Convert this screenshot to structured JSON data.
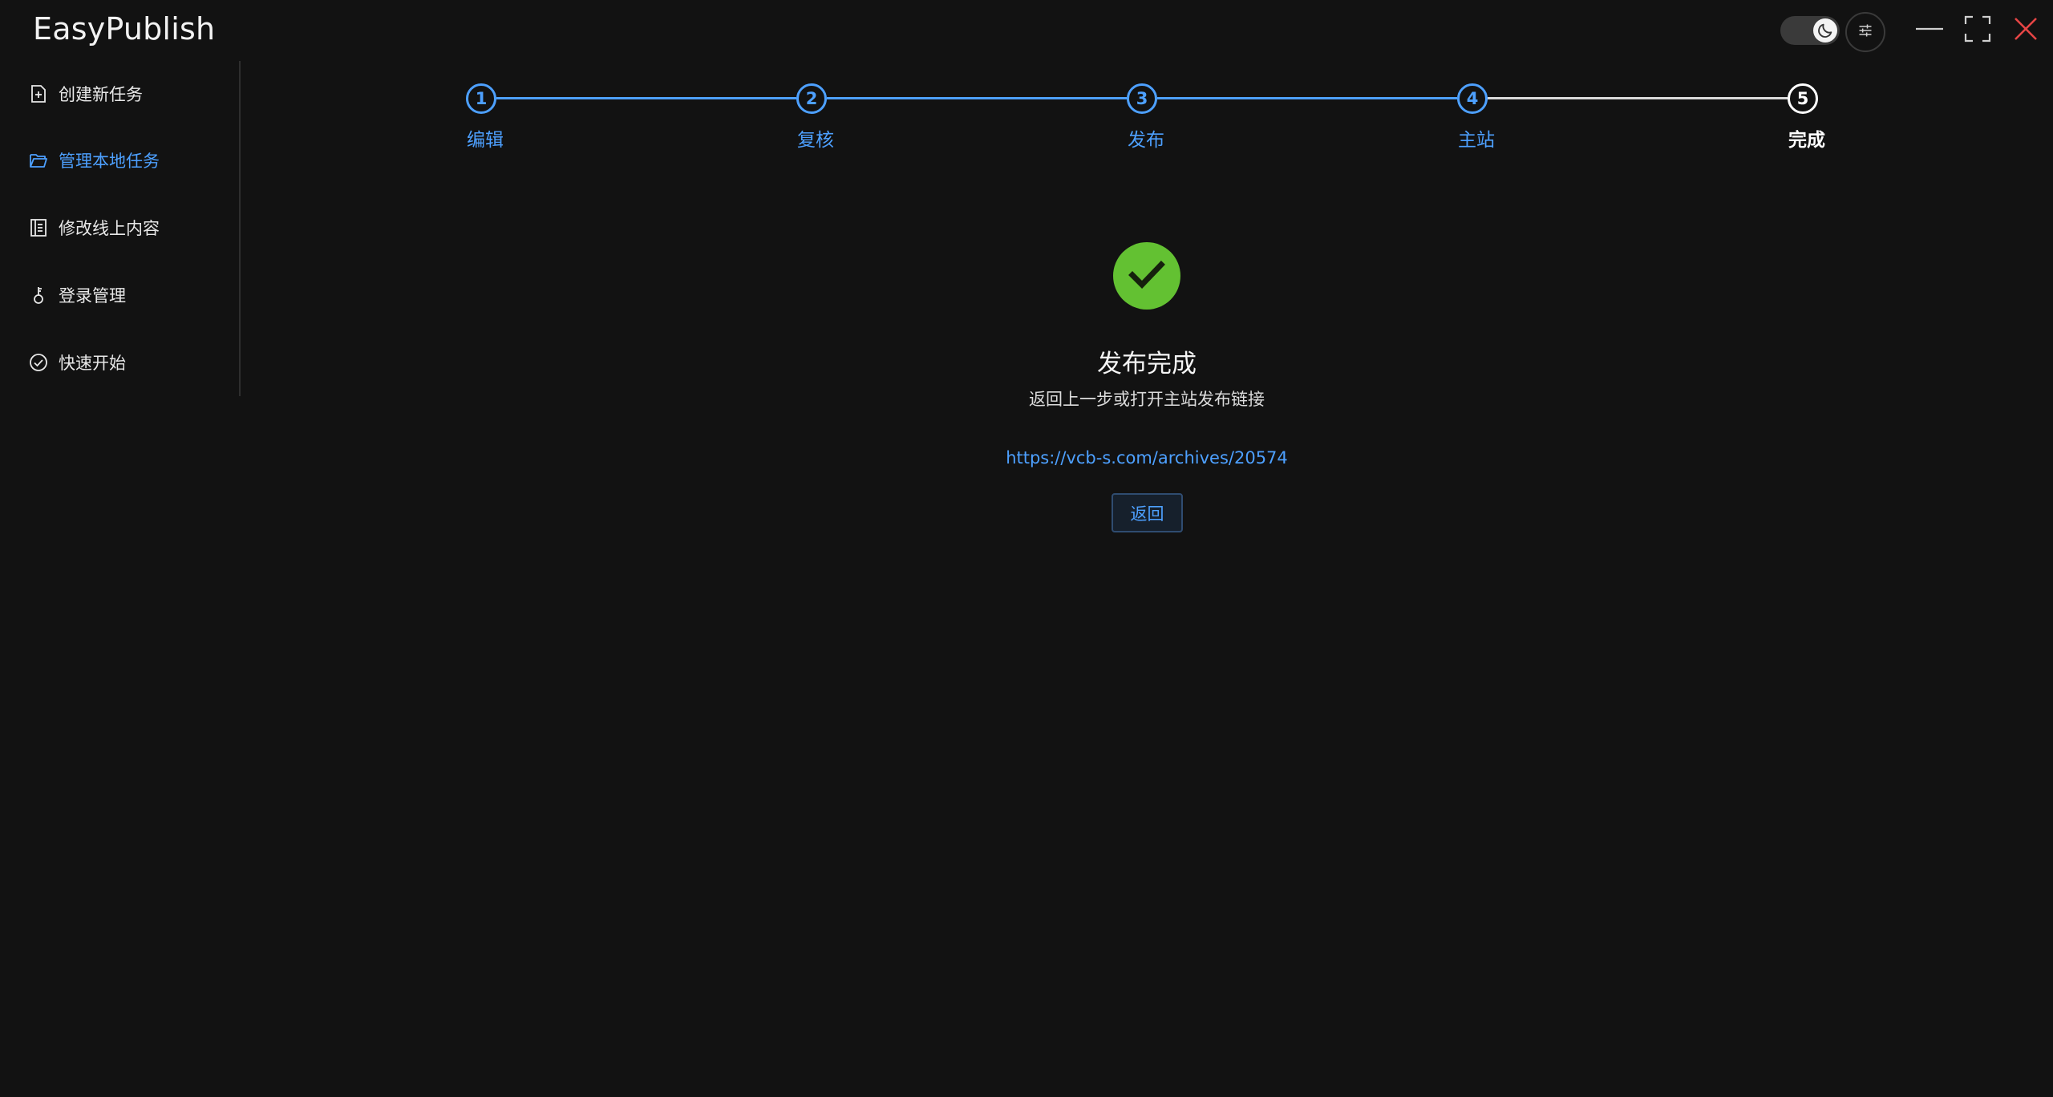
{
  "app": {
    "title": "EasyPublish"
  },
  "topbar": {
    "theme_toggle_icon": "moon-icon",
    "settings_icon": "sliders-icon",
    "minimize_icon": "minimize-icon",
    "maximize_icon": "maximize-icon",
    "close_icon": "close-icon",
    "close_color": "#e64545"
  },
  "sidebar": {
    "items": [
      {
        "label": "创建新任务",
        "icon": "file-add-icon",
        "active": false
      },
      {
        "label": "管理本地任务",
        "icon": "folder-open-icon",
        "active": true
      },
      {
        "label": "修改线上内容",
        "icon": "document-list-icon",
        "active": false
      },
      {
        "label": "登录管理",
        "icon": "key-icon",
        "active": false
      },
      {
        "label": "快速开始",
        "icon": "check-circle-icon",
        "active": false
      }
    ]
  },
  "steps": {
    "current": 5,
    "items": [
      {
        "number": "1",
        "label": "编辑"
      },
      {
        "number": "2",
        "label": "复核"
      },
      {
        "number": "3",
        "label": "发布"
      },
      {
        "number": "4",
        "label": "主站"
      },
      {
        "number": "5",
        "label": "完成"
      }
    ]
  },
  "result": {
    "status": "success",
    "icon": "check-icon",
    "icon_color": "#63c132",
    "title": "发布完成",
    "description": "返回上一步或打开主站发布链接",
    "link": "https://vcb-s.com/archives/20574",
    "back_button": "返回"
  },
  "colors": {
    "accent": "#4da0ff",
    "background": "#121212",
    "success": "#63c132"
  }
}
